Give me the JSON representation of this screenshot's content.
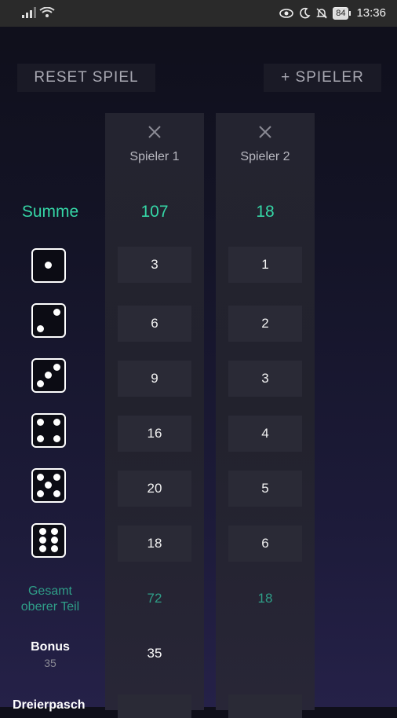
{
  "statusbar": {
    "battery": "84",
    "time": "13:36"
  },
  "actions": {
    "reset_label": "RESET SPIEL",
    "add_label": "+ SPIELER"
  },
  "players": [
    {
      "name": "Spieler 1",
      "sum": "107",
      "upper": [
        "3",
        "6",
        "9",
        "16",
        "20",
        "18"
      ],
      "gesamt": "72",
      "bonus": "35"
    },
    {
      "name": "Spieler 2",
      "sum": "18",
      "upper": [
        "1",
        "2",
        "3",
        "4",
        "5",
        "6"
      ],
      "gesamt": "18",
      "bonus": ""
    }
  ],
  "labels": {
    "summe": "Summe",
    "gesamt_line1": "Gesamt",
    "gesamt_line2": "oberer Teil",
    "bonus": "Bonus",
    "bonus_threshold": "35",
    "next_row": "Dreierpasch"
  },
  "icons": [
    "signal-icon",
    "wifi-icon",
    "eye-icon",
    "moon-icon",
    "bell-off-icon",
    "battery-icon",
    "close-icon",
    "dice-one-icon",
    "dice-two-icon",
    "dice-three-icon",
    "dice-four-icon",
    "dice-five-icon",
    "dice-six-icon"
  ],
  "colors": {
    "accent": "#35d6a6",
    "accent_dim": "#2f9e88",
    "statusbar": "#2a2a2a"
  }
}
